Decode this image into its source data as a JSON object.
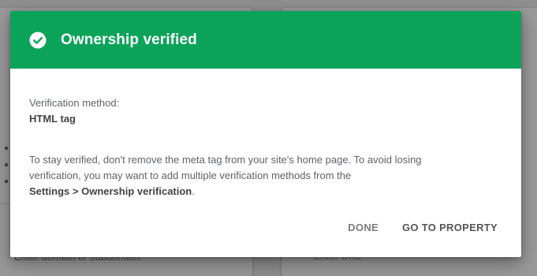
{
  "background": {
    "left_input_placeholder": "Enter domain or subdomain",
    "right_input_placeholder": "Enter URL"
  },
  "dialog": {
    "title": "Ownership verified",
    "icon": "check-circle-icon",
    "header_color": "#0ba35a",
    "method_label": "Verification method:",
    "method_value": "HTML tag",
    "info_text": "To stay verified, don't remove the meta tag from your site's home page. To avoid losing verification, you may want to add multiple verification methods from the",
    "info_link": "Settings > Ownership verification",
    "info_suffix": ".",
    "done_label": "DONE",
    "go_label": "GO TO PROPERTY"
  }
}
